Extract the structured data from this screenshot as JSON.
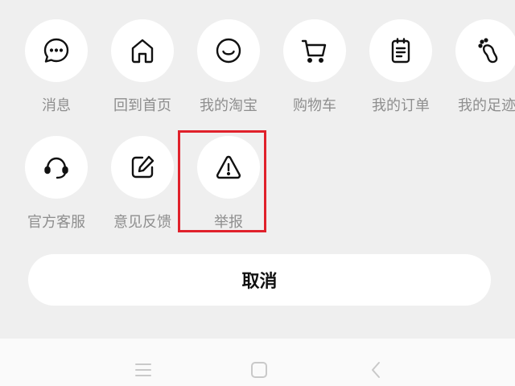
{
  "menu": {
    "items": [
      {
        "label": "消息",
        "icon": "message-icon"
      },
      {
        "label": "回到首页",
        "icon": "home-icon"
      },
      {
        "label": "我的淘宝",
        "icon": "smile-icon"
      },
      {
        "label": "购物车",
        "icon": "cart-icon"
      },
      {
        "label": "我的订单",
        "icon": "order-icon"
      },
      {
        "label": "我的足迹",
        "icon": "footprint-icon"
      },
      {
        "label": "官方客服",
        "icon": "headset-icon"
      },
      {
        "label": "意见反馈",
        "icon": "edit-icon"
      },
      {
        "label": "举报",
        "icon": "warning-icon"
      }
    ],
    "highlighted_item": "举报",
    "highlight_color": "#e0212b"
  },
  "cancel_button": {
    "label": "取消"
  },
  "navigation_bar": {
    "buttons": [
      "menu-icon",
      "home-square-icon",
      "back-icon"
    ]
  }
}
